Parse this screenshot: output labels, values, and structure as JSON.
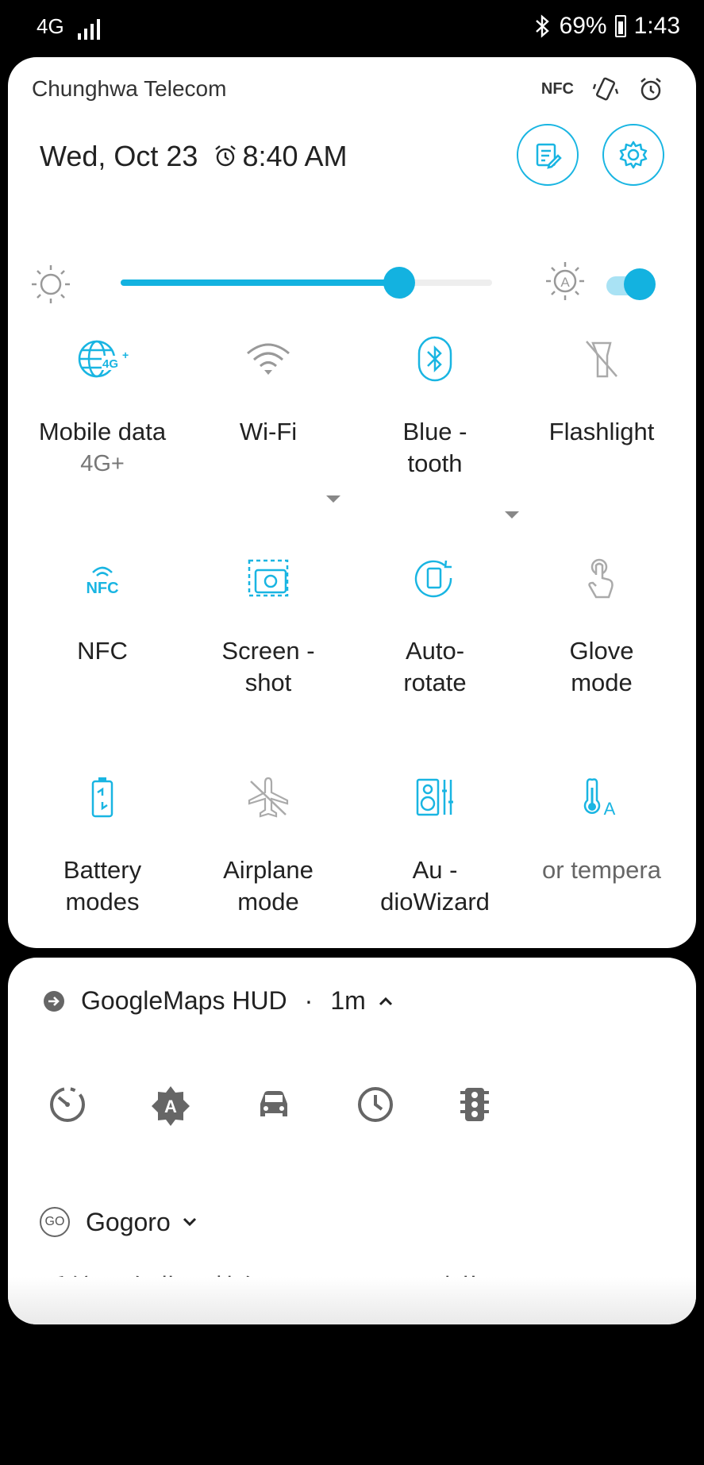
{
  "status_bar": {
    "network": "4G",
    "battery_percent": "69%",
    "time": "1:43",
    "icons": [
      "signal-icon",
      "bluetooth-icon",
      "battery-icon"
    ]
  },
  "quick_panel": {
    "carrier": "Chunghwa Telecom",
    "top_icons": [
      "nfc-icon",
      "vibrate-icon",
      "alarm-icon"
    ],
    "nfc_text": "NFC",
    "date": "Wed, Oct 23",
    "alarm_time": "8:40 AM",
    "brightness_level": 0.75,
    "auto_brightness": true,
    "accent": "#13b2e0",
    "tiles": [
      {
        "label": "Mobile data",
        "sub": "4G+",
        "icon": "mobile-data-icon",
        "active": true
      },
      {
        "label": "Wi-Fi",
        "sub": "",
        "icon": "wifi-icon",
        "active": false
      },
      {
        "label": "Blue - tooth",
        "sub": "",
        "icon": "bluetooth-icon",
        "active": true
      },
      {
        "label": "Flashlight",
        "sub": "",
        "icon": "flashlight-icon",
        "active": false
      },
      {
        "label": "NFC",
        "sub": "",
        "icon": "nfc-icon",
        "active": true
      },
      {
        "label": "Screen - shot",
        "sub": "",
        "icon": "screenshot-icon",
        "active": true
      },
      {
        "label": "Auto- rotate",
        "sub": "",
        "icon": "auto-rotate-icon",
        "active": true
      },
      {
        "label": "Glove mode",
        "sub": "",
        "icon": "glove-icon",
        "active": false
      },
      {
        "label": "Battery modes",
        "sub": "",
        "icon": "battery-modes-icon",
        "active": true
      },
      {
        "label": "Airplane mode",
        "sub": "",
        "icon": "airplane-icon",
        "active": false
      },
      {
        "label": "Au - dioWizard",
        "sub": "",
        "icon": "audiowizard-icon",
        "active": true
      },
      {
        "label": "or tempera",
        "sub": "",
        "icon": "color-temperature-icon",
        "active": true
      }
    ]
  },
  "notifications": {
    "maps": {
      "app": "GoogleMaps HUD",
      "separator": "·",
      "time": "1m",
      "actions": [
        "speedometer-icon",
        "auto-brightness-icon",
        "car-icon",
        "clock-icon",
        "traffic-light-icon"
      ]
    },
    "gogoro": {
      "app": "Gogoro",
      "badge": "GO",
      "body": "系統正在背景執行Gogoro app 點此可關閉 ··"
    }
  }
}
